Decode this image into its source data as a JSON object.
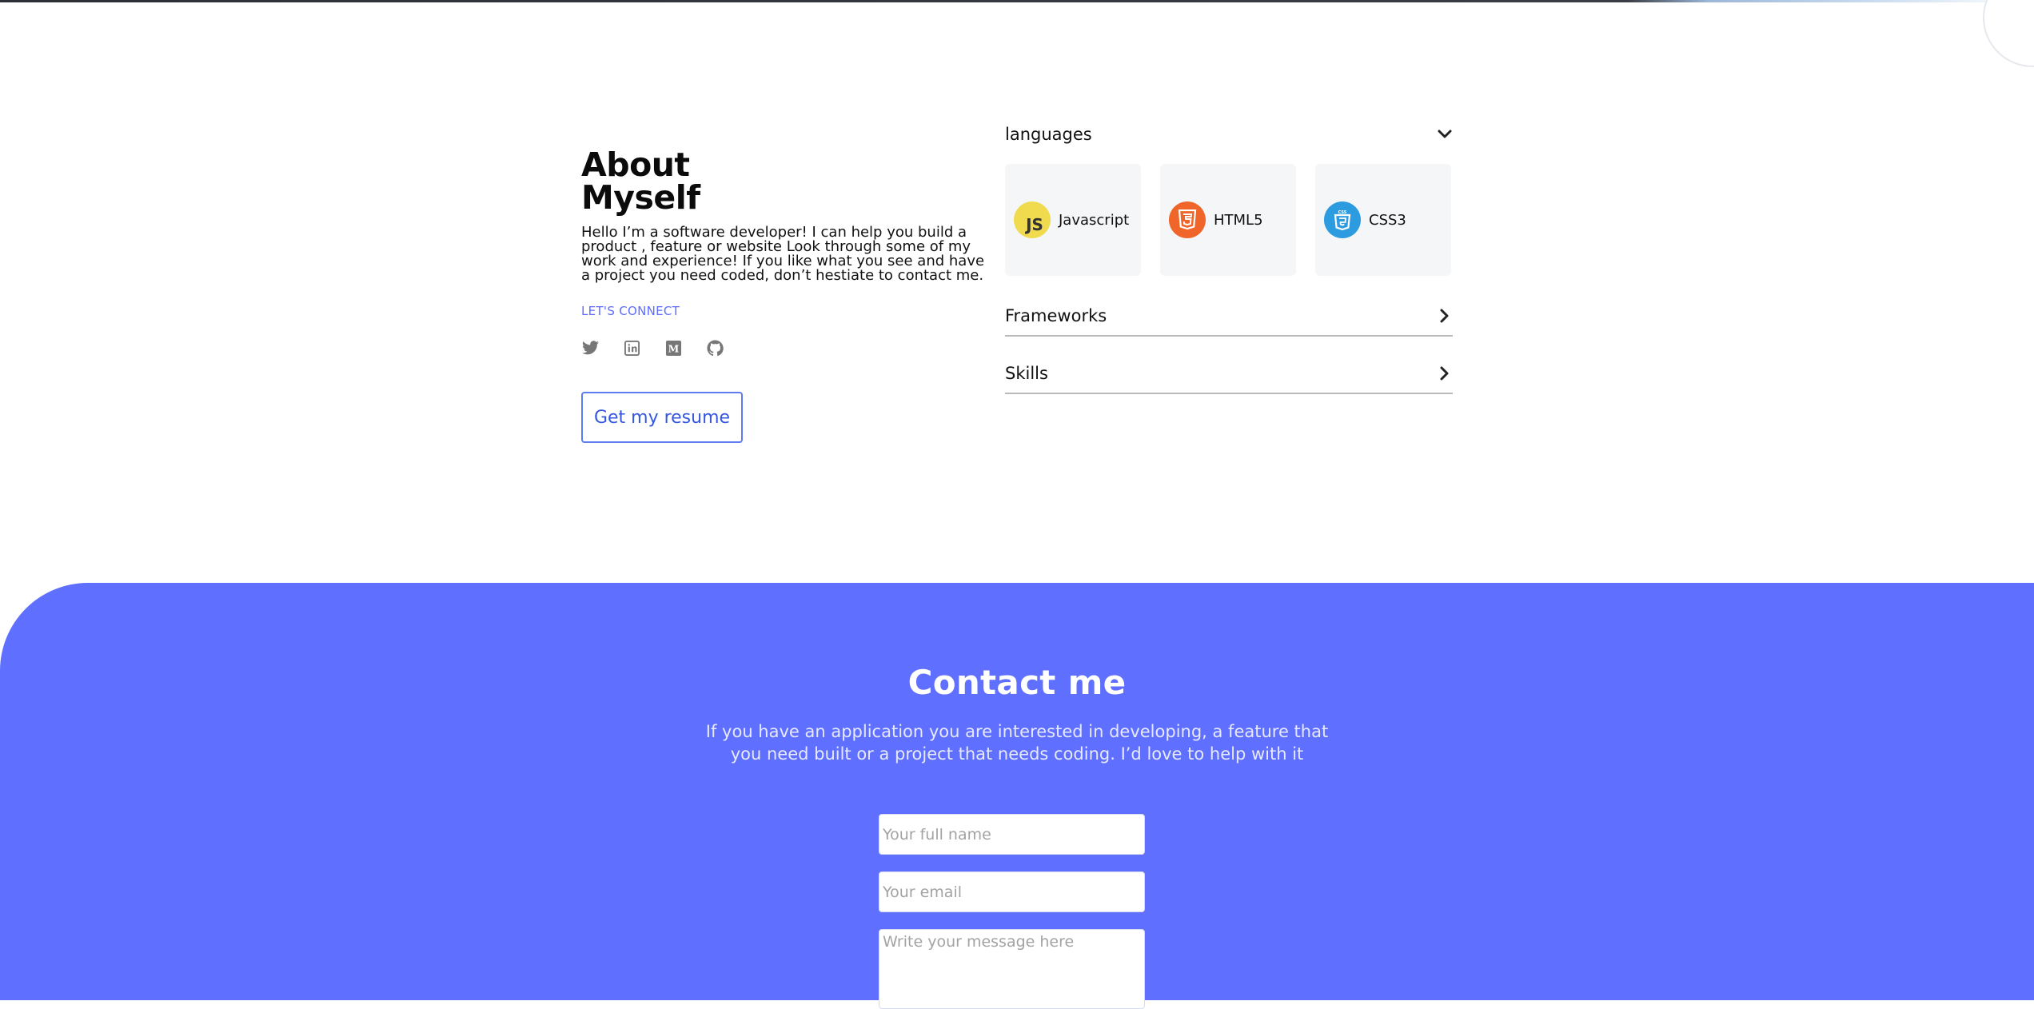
{
  "about": {
    "title_line1": "About",
    "title_line2": "Myself",
    "text": "Hello I’m a software developer! I can help you build a product , feature or website Look through some of my work and experience! If you like what you see and have a project you need coded, don’t hestiate to contact me.",
    "connect_label": "LET'S CONNECT",
    "socials": [
      "twitter-icon",
      "linkedin-icon",
      "medium-icon",
      "github-icon"
    ],
    "resume_button": "Get my resume"
  },
  "skills": {
    "languages_label": "languages",
    "languages": [
      {
        "name": "Javascript",
        "icon": "javascript-icon",
        "color": "#f0db4f"
      },
      {
        "name": "HTML5",
        "icon": "html5-icon",
        "color": "#f06529"
      },
      {
        "name": "CSS3",
        "icon": "css3-icon",
        "color": "#2d9be0"
      }
    ],
    "frameworks_label": "Frameworks",
    "skills_label": "Skills"
  },
  "contact": {
    "title": "Contact me",
    "subtitle": "If you have an application you are interested in developing, a feature that you need built or a project that needs coding. I’d love to help with it",
    "name_placeholder": "Your full name",
    "email_placeholder": "Your email",
    "message_placeholder": "Write your message here"
  },
  "colors": {
    "accent": "#5f6fff",
    "button_border": "#5d7cf0",
    "link": "#5f6dff"
  }
}
